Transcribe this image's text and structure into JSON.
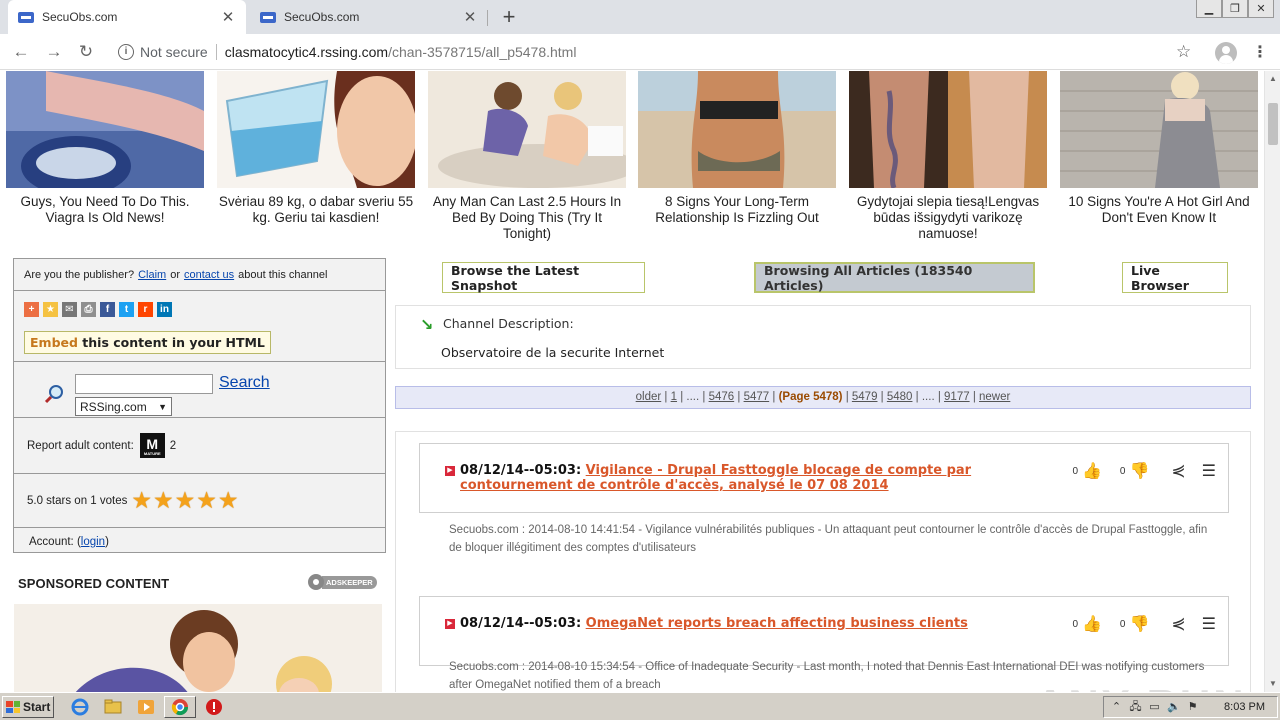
{
  "browser": {
    "tabs": [
      {
        "title": "SecuObs.com",
        "active": true
      },
      {
        "title": "SecuObs.com",
        "active": false
      }
    ],
    "new_tab": "+",
    "security_label": "Not secure",
    "url_host": "clasmatocytic4.rssing.com",
    "url_path": "/chan-3578715/all_p5478.html"
  },
  "ads": [
    {
      "caption": "Guys, You Need To Do This. Viagra Is Old News!"
    },
    {
      "caption": "Svėriau 89 kg, o dabar sveriu 55 kg. Geriu tai kasdien!"
    },
    {
      "caption": "Any Man Can Last 2.5 Hours In Bed By Doing This (Try It Tonight)"
    },
    {
      "caption": "8 Signs Your Long-Term Relationship Is Fizzling Out"
    },
    {
      "caption": "Gydytojai slepia tiesą!Lengvas būdas išsigydyti varikozę namuose!"
    },
    {
      "caption": "10 Signs You're A Hot Girl And Don't Even Know It"
    }
  ],
  "sidebar": {
    "publisher_prefix": "Are you the publisher?",
    "claim_link": "Claim",
    "or_text": "or",
    "contact_link": "contact us",
    "publisher_suffix": "about this channel",
    "embed_word": "Embed",
    "embed_rest": " this content in your HTML",
    "search_placeholder": "",
    "search_link": "Search",
    "search_scope": "RSSing.com",
    "report_label": "Report adult content:",
    "mature_letter": "M",
    "mature_sub": "MATURE",
    "report_count": "2",
    "rating_text": "5.0 stars on 1 votes",
    "rating_stars": 5,
    "account_prefix": "Account: (",
    "account_link": "login",
    "account_suffix": ")"
  },
  "sponsored": {
    "title": "SPONSORED CONTENT",
    "provider": "ADSKEEPER"
  },
  "nav_buttons": {
    "latest": "Browse the Latest Snapshot",
    "all": "Browsing All Articles (183540 Articles)",
    "live": "Live Browser"
  },
  "channel": {
    "label": "Channel Description:",
    "description": "Observatoire de la securite Internet"
  },
  "pager": {
    "older": "older",
    "p1": "1",
    "ellipsis": "....",
    "p5476": "5476",
    "p5477": "5477",
    "current": "(Page 5478)",
    "p5479": "5479",
    "p5480": "5480",
    "p9177": "9177",
    "newer": "newer"
  },
  "articles": [
    {
      "date": "08/12/14--05:03:",
      "title": "Vigilance - Drupal Fasttoggle blocage de compte par contournement de contrôle d'accès, analysé le 07 08 2014",
      "likes": "0",
      "dislikes": "0",
      "summary": "Secuobs.com : 2014-08-10 14:41:54 - Vigilance vulnérabilités publiques - Un attaquant peut contourner le contrôle d'accès de Drupal Fasttoggle, afin de bloquer illégitiment des comptes d'utilisateurs"
    },
    {
      "date": "08/12/14--05:03:",
      "title": "OmegaNet reports breach affecting business clients",
      "likes": "0",
      "dislikes": "0",
      "summary": "Secuobs.com : 2014-08-10 15:34:54 - Office of Inadequate Security - Last month, I noted that Dennis East International DEI was notifying customers after OmegaNet notified them of a breach"
    }
  ],
  "watermark": "ANY RUN",
  "taskbar": {
    "start": "Start",
    "clock": "8:03 PM"
  }
}
